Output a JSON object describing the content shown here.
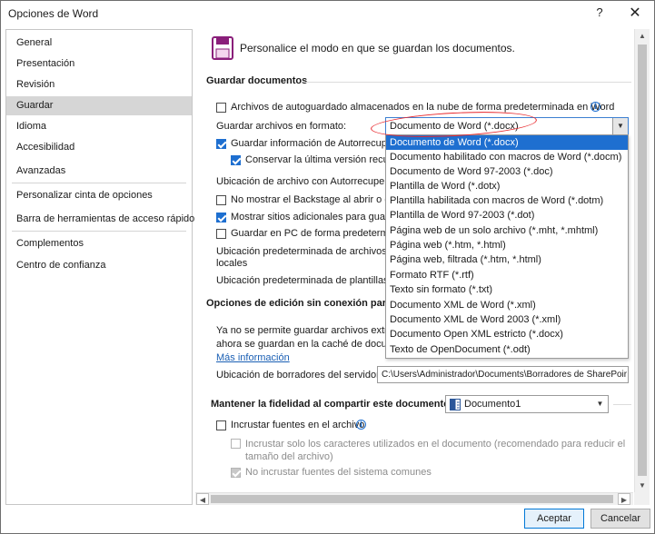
{
  "window": {
    "title": "Opciones de Word",
    "help_glyph": "?",
    "close_glyph": "✕"
  },
  "sidebar": {
    "items": [
      {
        "label": "General"
      },
      {
        "label": "Presentación"
      },
      {
        "label": "Revisión"
      },
      {
        "label": "Guardar",
        "selected": true
      },
      {
        "label": "Idioma"
      },
      {
        "label": "Accesibilidad"
      },
      {
        "label": "Avanzadas"
      },
      {
        "label": "Personalizar cinta de opciones"
      },
      {
        "label": "Barra de herramientas de acceso rápido"
      },
      {
        "label": "Complementos"
      },
      {
        "label": "Centro de confianza"
      }
    ]
  },
  "header": {
    "icon": "save-icon",
    "text": "Personalice el modo en que se guardan los documentos."
  },
  "save_section": {
    "title": "Guardar documentos",
    "autosave_cloud": {
      "label": "Archivos de autoguardado almacenados en la nube de forma predeterminada en Word",
      "checked": false
    },
    "format_label": "Guardar archivos en formato:",
    "format_value": "Documento de Word (*.docx)",
    "autorecover": {
      "label": "Guardar información de Autorrecuperación",
      "checked": true
    },
    "keep_last": {
      "label": "Conservar la última versión recupe",
      "checked": true
    },
    "autorecover_location_label": "Ubicación de archivo con Autorrecuperac",
    "no_backstage": {
      "label": "No mostrar el Backstage al abrir o gua",
      "checked": false
    },
    "show_places": {
      "label": "Mostrar sitios adicionales para guarda",
      "checked": true
    },
    "save_pc_default": {
      "label": "Guardar en PC de forma predetermina",
      "checked": false
    },
    "local_default_label": "Ubicación predeterminada de archivos locales",
    "templates_default_label": "Ubicación predeterminada de plantillas p"
  },
  "format_dropdown": {
    "options": [
      {
        "label": "Documento de Word (*.docx)",
        "selected": true
      },
      {
        "label": "Documento habilitado con macros de Word (*.docm)"
      },
      {
        "label": "Documento de Word 97-2003 (*.doc)"
      },
      {
        "label": "Plantilla de Word (*.dotx)"
      },
      {
        "label": "Plantilla habilitada con macros de Word (*.dotm)"
      },
      {
        "label": "Plantilla de Word 97-2003 (*.dot)"
      },
      {
        "label": "Página web de un solo archivo (*.mht, *.mhtml)"
      },
      {
        "label": "Página web (*.htm, *.html)"
      },
      {
        "label": "Página web, filtrada (*.htm, *.html)"
      },
      {
        "label": "Formato RTF (*.rtf)"
      },
      {
        "label": "Texto sin formato (*.txt)"
      },
      {
        "label": "Documento XML de Word (*.xml)"
      },
      {
        "label": "Documento XML de Word 2003 (*.xml)"
      },
      {
        "label": "Documento Open XML estricto (*.docx)"
      },
      {
        "label": "Texto de OpenDocument (*.odt)"
      }
    ]
  },
  "offline_section": {
    "title": "Opciones de edición sin conexión para los",
    "line1": "Ya no se permite guardar archivos extraíd",
    "line2": "ahora se guardan en la caché de docume",
    "more_info": "Más información",
    "drafts_label": "Ubicación de borradores del servidor:",
    "drafts_value": "C:\\Users\\Administrador\\Documents\\Borradores de SharePoir"
  },
  "fidelity_section": {
    "title": "Mantener la fidelidad al compartir este documento:",
    "doc_value": "Documento1",
    "embed_fonts": {
      "label": "Incrustar fuentes en el archivo",
      "checked": false
    },
    "embed_used_chars": {
      "label": "Incrustar solo los caracteres utilizados en el documento (recomendado para reducir el tamaño del archivo)",
      "checked": false
    },
    "no_system_fonts": {
      "label": "No incrustar fuentes del sistema comunes",
      "checked": true
    }
  },
  "footer": {
    "ok_label": "Aceptar",
    "cancel_label": "Cancelar"
  },
  "colors": {
    "accent": "#1e6fd0",
    "annotation": "#e8262b",
    "selected_nav": "#d6d6d6"
  }
}
